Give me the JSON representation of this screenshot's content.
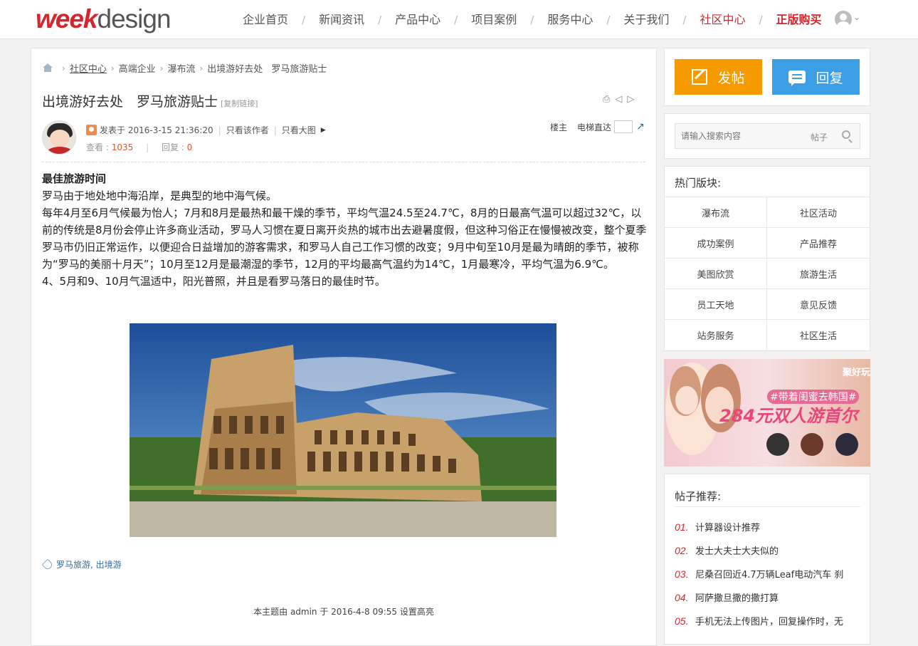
{
  "header": {
    "logo_week": "week",
    "logo_design": "design",
    "nav": [
      {
        "label": "企业首页",
        "style": "normal"
      },
      {
        "label": "新闻资讯",
        "style": "normal"
      },
      {
        "label": "产品中心",
        "style": "normal"
      },
      {
        "label": "项目案例",
        "style": "normal"
      },
      {
        "label": "服务中心",
        "style": "normal"
      },
      {
        "label": "关于我们",
        "style": "normal"
      },
      {
        "label": "社区中心",
        "style": "active"
      },
      {
        "label": "正版购买",
        "style": "highlight"
      }
    ],
    "separator": "/"
  },
  "breadcrumb": {
    "items": [
      "社区中心",
      "高端企业",
      "瀑布流",
      "出境游好去处",
      "罗马旅游贴士"
    ]
  },
  "post": {
    "title": "出境游好去处　罗马旅游贴士",
    "copy_link": "[复制链接]",
    "posted_at": "发表于 2016-3-15 21:36:20",
    "only_author": "只看该作者",
    "only_big_image": "只看大图",
    "views_label": "查看 : ",
    "views": "1035",
    "replies_label": "回复 : ",
    "replies": "0",
    "floor_owner": "楼主",
    "elevator": "电梯直达",
    "heading": "最佳旅游时间",
    "paragraphs": [
      "罗马由于地处地中海沿岸，是典型的地中海气候。",
      "每年4月至6月气候最为怡人；7月和8月是最热和最干燥的季节，平均气温24.5至24.7℃，8月的日最高气温可以超过32℃，以前的传统是8月份会停止许多商业活动，罗马人习惯在夏日离开炎热的城市出去避暑度假，但这种习俗正在慢慢被改变，整个夏季罗马市仍旧正常运作，以便迎合日益增加的游客需求，和罗马人自己工作习惯的改变；9月中旬至10月是最为晴朗的季节，被称为“罗马的美丽十月天”；10月至12月是最潮湿的季节，12月的平均最高气温约为14℃，1月最寒冷，平均气温为6.9℃。",
      "4、5月和9、10月气温适中，阳光普照，并且是看罗马落日的最佳时节。"
    ],
    "tags": "罗马旅游, 出境游",
    "highlight_note": "本主题由 admin 于 2016-4-8 09:55 设置高亮"
  },
  "sidebar": {
    "post_button": "发帖",
    "reply_button": "回复",
    "search_placeholder": "请输入搜索内容",
    "search_scope": "帖子",
    "hot_title": "热门版块:",
    "hot_boards": [
      "瀑布流",
      "社区活动",
      "成功案例",
      "产品推荐",
      "美图欣赏",
      "旅游生活",
      "员工天地",
      "意见反馈",
      "站务服务",
      "社区生活"
    ],
    "ad": {
      "brand": "聚好玩",
      "tagline": "#带着闺蜜去韩国#",
      "headline": "284元双人游首尔"
    },
    "rec_title": "帖子推荐:",
    "recommendations": [
      {
        "idx": "01.",
        "title": "计算器设计推荐"
      },
      {
        "idx": "02.",
        "title": "发士大夫士大夫似的"
      },
      {
        "idx": "03.",
        "title": "尼桑召回近4.7万辆Leaf电动汽车 刹"
      },
      {
        "idx": "04.",
        "title": "阿萨撒旦撒的撒打算"
      },
      {
        "idx": "05.",
        "title": "手机无法上传图片，回复操作时，无"
      }
    ]
  },
  "colors": {
    "brand_red": "#d4262d",
    "post_button": "#f59b00",
    "reply_button": "#3c9ee5",
    "link_blue": "#2f6ea5"
  }
}
